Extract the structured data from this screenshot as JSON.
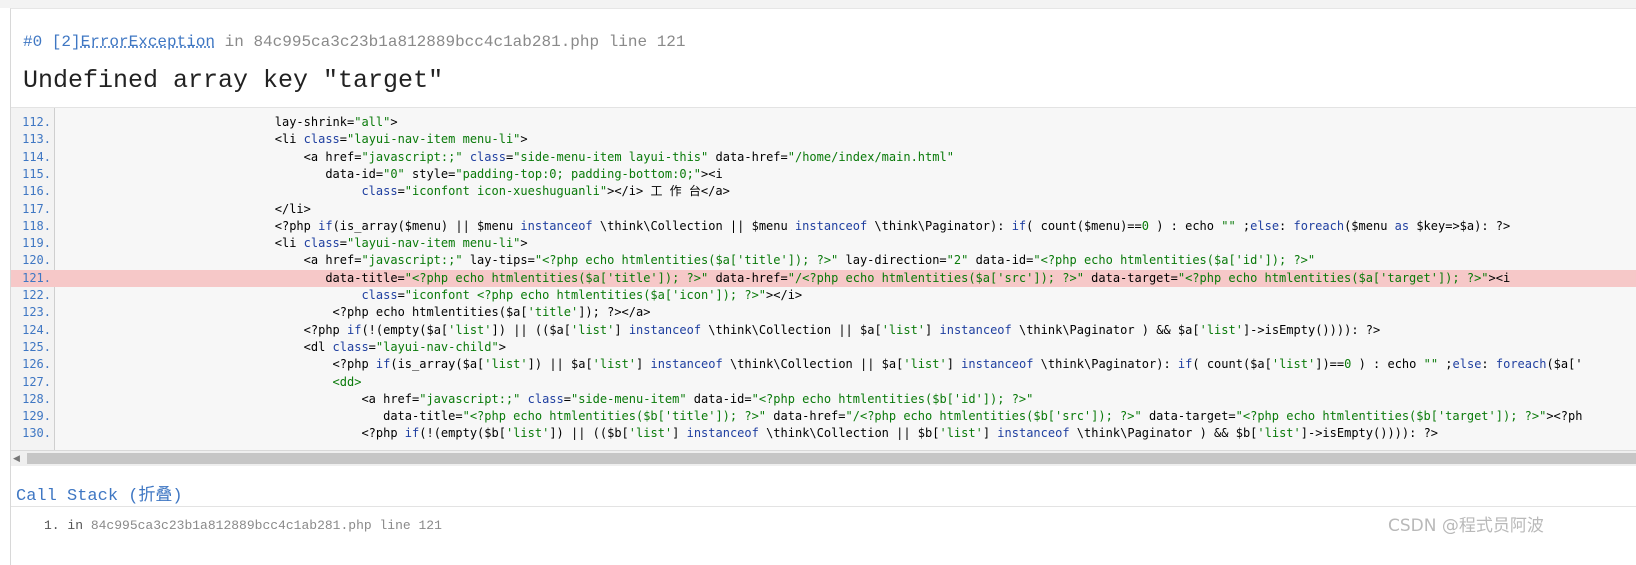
{
  "error": {
    "prefix": "#0 [2]",
    "exception_class": "ErrorException",
    "in_text": " in ",
    "file": "84c995ca3c23b1a812889bcc4c1ab281.php",
    "line_text": " line 121",
    "message": "Undefined array key \"target\""
  },
  "source": {
    "highlight_line": 121,
    "lines": [
      {
        "no": "112.",
        "indent": 30,
        "tokens": [
          [
            "t",
            "lay-shrink="
          ],
          [
            "s",
            "\"all\""
          ],
          [
            "t",
            ">"
          ]
        ]
      },
      {
        "no": "113.",
        "indent": 30,
        "tokens": [
          [
            "t",
            "<li "
          ],
          [
            "k",
            "class"
          ],
          [
            "t",
            "="
          ],
          [
            "s",
            "\"layui-nav-item menu-li\""
          ],
          [
            "t",
            ">"
          ]
        ]
      },
      {
        "no": "114.",
        "indent": 34,
        "tokens": [
          [
            "t",
            "<a href="
          ],
          [
            "s",
            "\"javascript:;\""
          ],
          [
            "t",
            " "
          ],
          [
            "k",
            "class"
          ],
          [
            "t",
            "="
          ],
          [
            "s",
            "\"side-menu-item layui-this\""
          ],
          [
            "t",
            " data-href="
          ],
          [
            "s",
            "\"/home/index/main.html\""
          ]
        ]
      },
      {
        "no": "115.",
        "indent": 37,
        "tokens": [
          [
            "t",
            "data-id="
          ],
          [
            "s",
            "\"0\""
          ],
          [
            "t",
            " style="
          ],
          [
            "s",
            "\"padding-top:0; padding-bottom:0;\""
          ],
          [
            "t",
            "><i"
          ]
        ]
      },
      {
        "no": "116.",
        "indent": 42,
        "tokens": [
          [
            "k",
            "class"
          ],
          [
            "t",
            "="
          ],
          [
            "s",
            "\"iconfont icon-xueshuguanli\""
          ],
          [
            "t",
            "></i> 工 作 台</a>"
          ]
        ]
      },
      {
        "no": "117.",
        "indent": 30,
        "tokens": [
          [
            "t",
            "</li>"
          ]
        ]
      },
      {
        "no": "118.",
        "indent": 30,
        "tokens": [
          [
            "t",
            "<?php "
          ],
          [
            "k",
            "if"
          ],
          [
            "t",
            "(is_array($menu) || $menu "
          ],
          [
            "k",
            "instanceof"
          ],
          [
            "t",
            " \\think\\Collection || $menu "
          ],
          [
            "k",
            "instanceof"
          ],
          [
            "t",
            " \\think\\Paginator): "
          ],
          [
            "k",
            "if"
          ],
          [
            "t",
            "( count($menu)=="
          ],
          [
            "s",
            "0"
          ],
          [
            "t",
            " ) : echo "
          ],
          [
            "s",
            "\"\""
          ],
          [
            "t",
            " ;"
          ],
          [
            "k",
            "else"
          ],
          [
            "t",
            ": "
          ],
          [
            "k",
            "foreach"
          ],
          [
            "t",
            "($menu "
          ],
          [
            "k",
            "as"
          ],
          [
            "t",
            " $key=>$a): ?>"
          ]
        ]
      },
      {
        "no": "119.",
        "indent": 30,
        "tokens": [
          [
            "t",
            "<li "
          ],
          [
            "k",
            "class"
          ],
          [
            "t",
            "="
          ],
          [
            "s",
            "\"layui-nav-item menu-li\""
          ],
          [
            "t",
            ">"
          ]
        ]
      },
      {
        "no": "120.",
        "indent": 34,
        "tokens": [
          [
            "t",
            "<a href="
          ],
          [
            "s",
            "\"javascript:;\""
          ],
          [
            "t",
            " lay-tips="
          ],
          [
            "s",
            "\"<?php echo htmlentities($a['title']); ?>\""
          ],
          [
            "t",
            " lay-direction="
          ],
          [
            "s",
            "\"2\""
          ],
          [
            "t",
            " data-id="
          ],
          [
            "s",
            "\"<?php echo htmlentities($a['id']); ?>\""
          ]
        ]
      },
      {
        "no": "121.",
        "indent": 37,
        "tokens": [
          [
            "t",
            "data-title="
          ],
          [
            "s",
            "\"<?php echo htmlentities($a['title']); ?>\""
          ],
          [
            "t",
            " data-href="
          ],
          [
            "s",
            "\"/<?php echo htmlentities($a['src']); ?>\""
          ],
          [
            "t",
            " data-target="
          ],
          [
            "s",
            "\"<?php echo htmlentities($a['target']); ?>\""
          ],
          [
            "t",
            "><i"
          ]
        ]
      },
      {
        "no": "122.",
        "indent": 42,
        "tokens": [
          [
            "k",
            "class"
          ],
          [
            "t",
            "="
          ],
          [
            "s",
            "\"iconfont <?php echo htmlentities($a['icon']); ?>\""
          ],
          [
            "t",
            "></i>"
          ]
        ]
      },
      {
        "no": "123.",
        "indent": 38,
        "tokens": [
          [
            "t",
            "<?php echo htmlentities($a["
          ],
          [
            "s",
            "'title'"
          ],
          [
            "t",
            "]); ?></a>"
          ]
        ]
      },
      {
        "no": "124.",
        "indent": 34,
        "tokens": [
          [
            "t",
            "<?php "
          ],
          [
            "k",
            "if"
          ],
          [
            "t",
            "(!(empty($a["
          ],
          [
            "s",
            "'list'"
          ],
          [
            "t",
            "]) || (($a["
          ],
          [
            "s",
            "'list'"
          ],
          [
            "t",
            "] "
          ],
          [
            "k",
            "instanceof"
          ],
          [
            "t",
            " \\think\\Collection || $a["
          ],
          [
            "s",
            "'list'"
          ],
          [
            "t",
            "] "
          ],
          [
            "k",
            "instanceof"
          ],
          [
            "t",
            " \\think\\Paginator ) && $a["
          ],
          [
            "s",
            "'list'"
          ],
          [
            "t",
            "]->isEmpty()))): ?>"
          ]
        ]
      },
      {
        "no": "125.",
        "indent": 34,
        "tokens": [
          [
            "t",
            "<dl "
          ],
          [
            "k",
            "class"
          ],
          [
            "t",
            "="
          ],
          [
            "s",
            "\"layui-nav-child\""
          ],
          [
            "t",
            ">"
          ]
        ]
      },
      {
        "no": "126.",
        "indent": 38,
        "tokens": [
          [
            "t",
            "<?php "
          ],
          [
            "k",
            "if"
          ],
          [
            "t",
            "(is_array($a["
          ],
          [
            "s",
            "'list'"
          ],
          [
            "t",
            "]) || $a["
          ],
          [
            "s",
            "'list'"
          ],
          [
            "t",
            "] "
          ],
          [
            "k",
            "instanceof"
          ],
          [
            "t",
            " \\think\\Collection || $a["
          ],
          [
            "s",
            "'list'"
          ],
          [
            "t",
            "] "
          ],
          [
            "k",
            "instanceof"
          ],
          [
            "t",
            " \\think\\Paginator): "
          ],
          [
            "k",
            "if"
          ],
          [
            "t",
            "( count($a["
          ],
          [
            "s",
            "'list'"
          ],
          [
            "t",
            "])=="
          ],
          [
            "s",
            "0"
          ],
          [
            "t",
            " ) : echo "
          ],
          [
            "s",
            "\"\""
          ],
          [
            "t",
            " ;"
          ],
          [
            "k",
            "else"
          ],
          [
            "t",
            ": "
          ],
          [
            "k",
            "foreach"
          ],
          [
            "t",
            "($a['"
          ]
        ]
      },
      {
        "no": "127.",
        "indent": 38,
        "tokens": [
          [
            "s",
            "<dd>"
          ]
        ]
      },
      {
        "no": "128.",
        "indent": 42,
        "tokens": [
          [
            "t",
            "<a href="
          ],
          [
            "s",
            "\"javascript:;\""
          ],
          [
            "t",
            " "
          ],
          [
            "k",
            "class"
          ],
          [
            "t",
            "="
          ],
          [
            "s",
            "\"side-menu-item\""
          ],
          [
            "t",
            " data-id="
          ],
          [
            "s",
            "\"<?php echo htmlentities($b['id']); ?>\""
          ]
        ]
      },
      {
        "no": "129.",
        "indent": 45,
        "tokens": [
          [
            "t",
            "data-title="
          ],
          [
            "s",
            "\"<?php echo htmlentities($b['title']); ?>\""
          ],
          [
            "t",
            " data-href="
          ],
          [
            "s",
            "\"/<?php echo htmlentities($b['src']); ?>\""
          ],
          [
            "t",
            " data-target="
          ],
          [
            "s",
            "\"<?php echo htmlentities($b['target']); ?>\""
          ],
          [
            "t",
            "><?ph"
          ]
        ]
      },
      {
        "no": "130.",
        "indent": 42,
        "tokens": [
          [
            "t",
            "<?php "
          ],
          [
            "k",
            "if"
          ],
          [
            "t",
            "(!(empty($b["
          ],
          [
            "s",
            "'list'"
          ],
          [
            "t",
            "]) || (($b["
          ],
          [
            "s",
            "'list'"
          ],
          [
            "t",
            "] "
          ],
          [
            "k",
            "instanceof"
          ],
          [
            "t",
            " \\think\\Collection || $b["
          ],
          [
            "s",
            "'list'"
          ],
          [
            "t",
            "] "
          ],
          [
            "k",
            "instanceof"
          ],
          [
            "t",
            " \\think\\Paginator ) && $b["
          ],
          [
            "s",
            "'list'"
          ],
          [
            "t",
            "]->isEmpty()))): ?>"
          ]
        ]
      }
    ]
  },
  "call_stack": {
    "title": "Call Stack (折叠)",
    "items": [
      {
        "index": "1.",
        "prefix": "in ",
        "file": "84c995ca3c23b1a812889bcc4c1ab281.php",
        "line": " line 121"
      }
    ]
  },
  "watermark": "CSDN @程式员阿波",
  "colors": {
    "link_blue": "#3f77c3",
    "keyword_blue": "#1f3fa0",
    "string_green": "#0a7a0a",
    "highlight_red": "#f6c8c8"
  }
}
